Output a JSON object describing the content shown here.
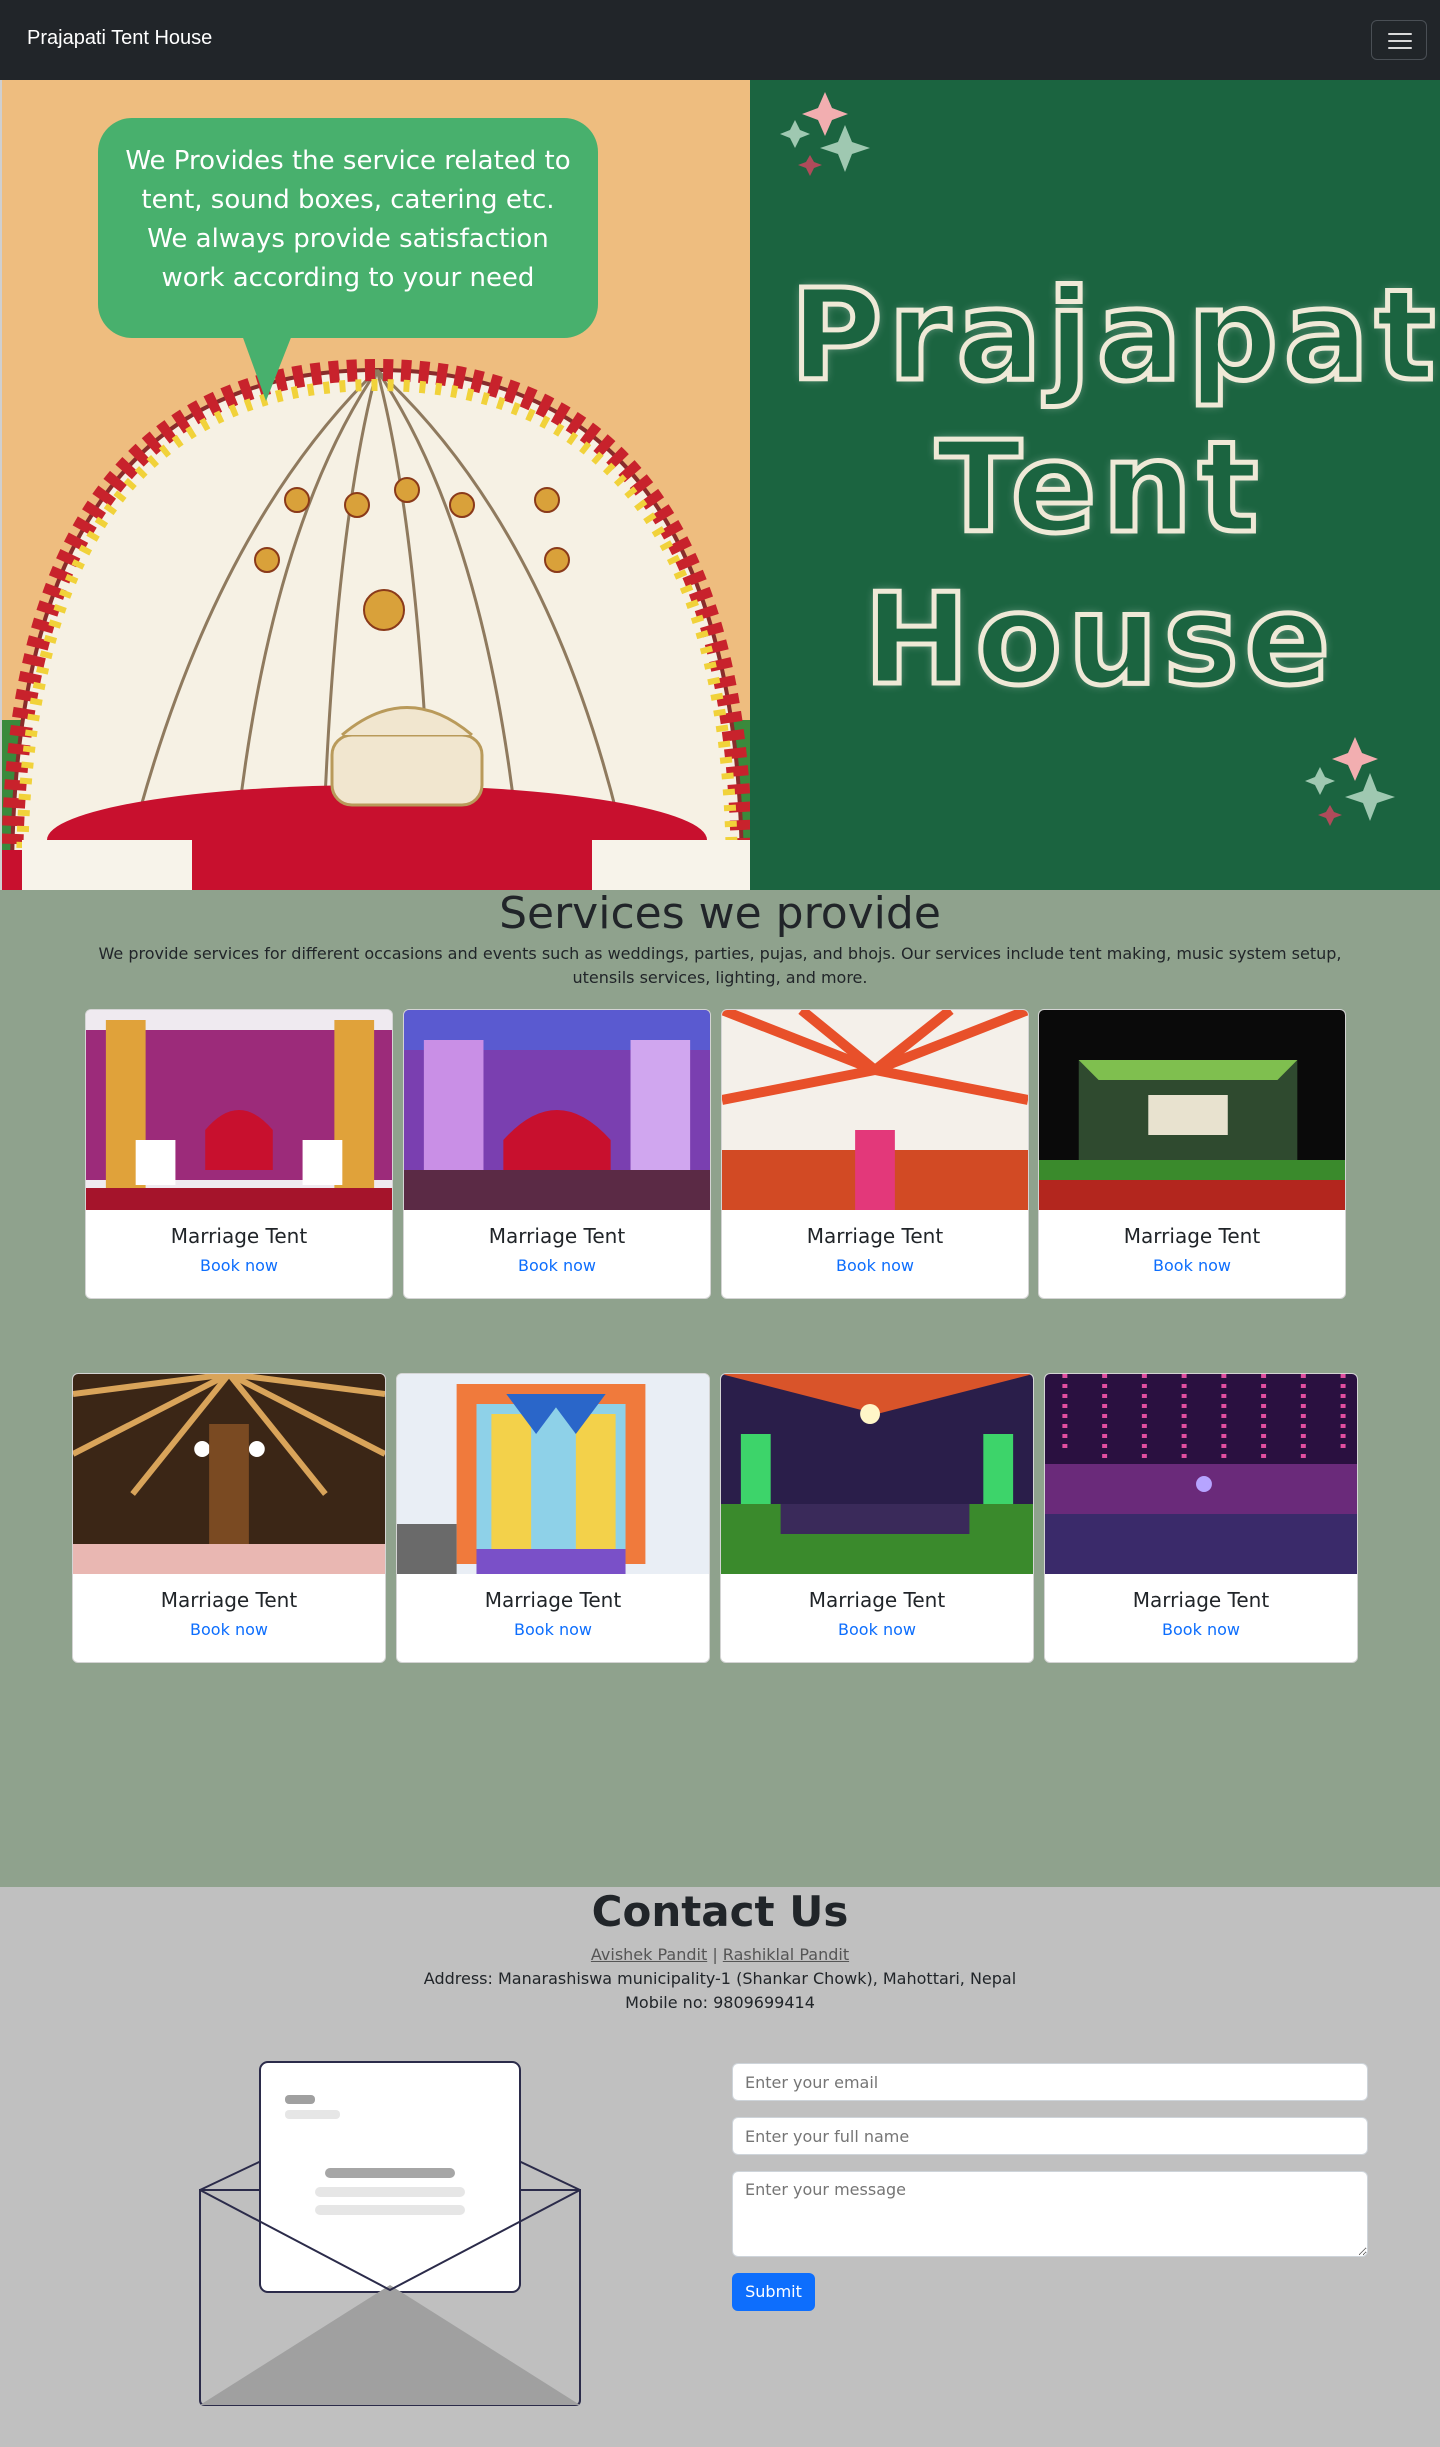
{
  "navbar": {
    "brand": "Prajapati Tent House",
    "toggle_icon": "hamburger-menu-icon"
  },
  "hero": {
    "bubble_text": "We Provides the service related to tent, sound boxes, catering etc. We always provide satisfaction work according to your need",
    "title_lines": [
      "Prajapati",
      "Tent",
      "House"
    ],
    "colors": {
      "left_bg": "#eebd7f",
      "right_bg": "#1b6440",
      "bubble": "#48b06d"
    }
  },
  "services": {
    "title": "Services we provide",
    "description": "We provide services for different occasions and events such as weddings, parties, pujas, and bhojs. Our services include tent making, music system setup, utensils services, lighting, and more.",
    "row1": [
      {
        "title": "Marriage Tent",
        "link": "Book now"
      },
      {
        "title": "Marriage Tent",
        "link": "Book now"
      },
      {
        "title": "Marriage Tent",
        "link": "Book now"
      },
      {
        "title": "Marriage Tent",
        "link": "Book now"
      }
    ],
    "row2": [
      {
        "title": "Marriage Tent",
        "link": "Book now"
      },
      {
        "title": "Marriage Tent",
        "link": "Book now"
      },
      {
        "title": "Marriage Tent",
        "link": "Book now"
      },
      {
        "title": "Marriage Tent",
        "link": "Book now"
      }
    ],
    "colors": {
      "section_bg": "#8fa28d",
      "link": "#0d6efd"
    }
  },
  "contact": {
    "title": "Contact Us",
    "name1": "Avishek Pandit",
    "separator": " | ",
    "name2": "Rashiklal Pandit",
    "address": "Address: Manarashiswa municipality-1 (Shankar Chowk), Mahottari, Nepal",
    "mobile": "Mobile no: 9809699414",
    "form": {
      "email_placeholder": "Enter your email",
      "name_placeholder": "Enter your full name",
      "message_placeholder": "Enter your message",
      "submit_label": "Submit"
    },
    "colors": {
      "section_bg": "#c0c0c0",
      "button": "#0d6efd"
    }
  }
}
